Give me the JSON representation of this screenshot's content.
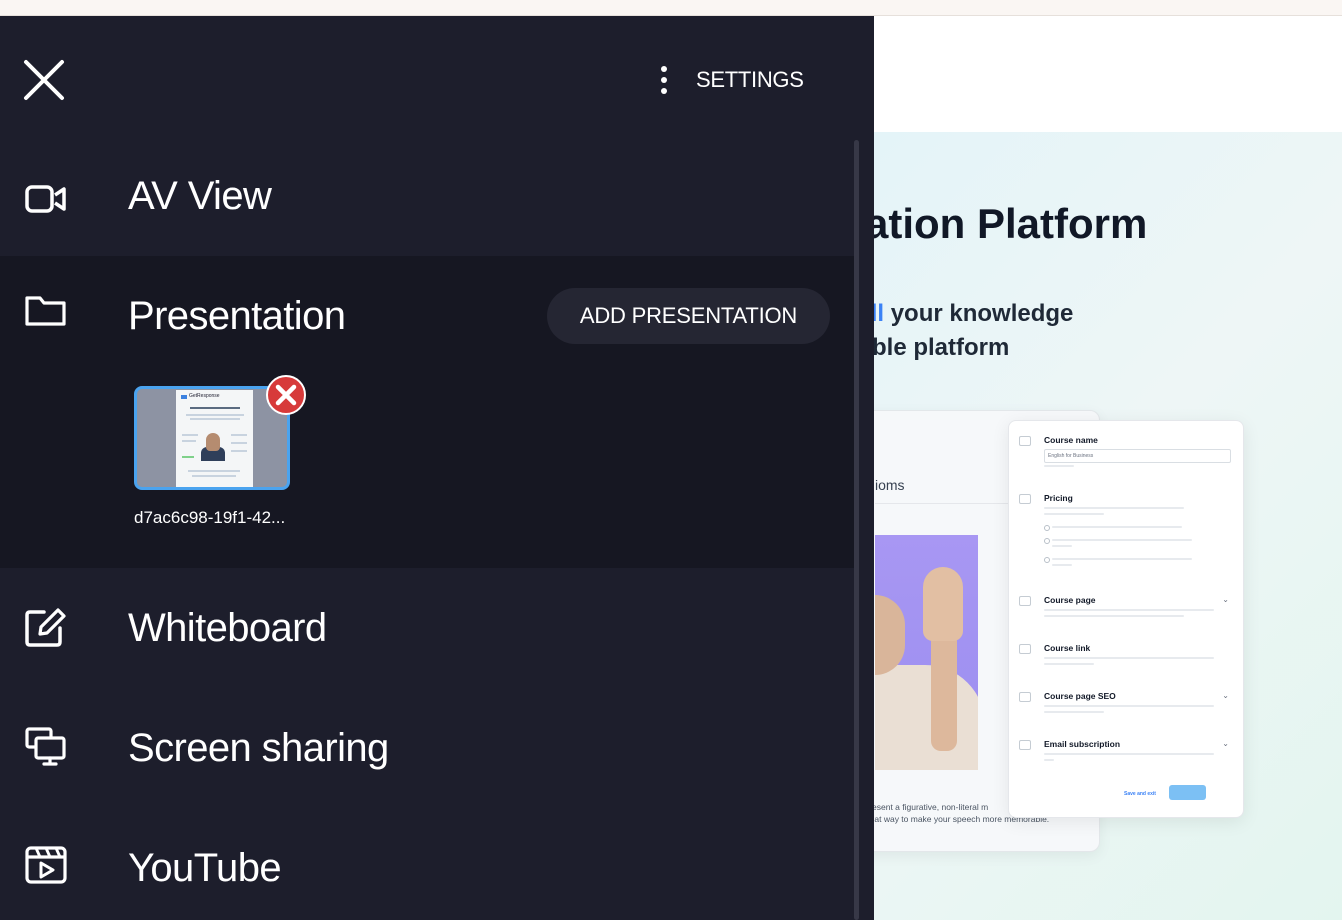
{
  "header": {
    "settings_label": "SETTINGS",
    "close_icon": "close-icon",
    "more_icon": "more-vertical-icon"
  },
  "menu": {
    "av_view": {
      "label": "AV View",
      "icon": "video-camera-icon"
    },
    "presentation": {
      "label": "Presentation",
      "icon": "folder-icon",
      "add_label": "ADD PRESENTATION"
    },
    "whiteboard": {
      "label": "Whiteboard",
      "icon": "edit-icon"
    },
    "screen_sharing": {
      "label": "Screen sharing",
      "icon": "screen-share-icon"
    },
    "youtube": {
      "label": "YouTube",
      "icon": "youtube-icon"
    }
  },
  "presentation_files": [
    {
      "name": "d7ac6c98-19f1-42...",
      "thumb_brand": "GetResponse"
    }
  ],
  "slide": {
    "title": "zation Platform",
    "subtitle_line1_highlight": "sell",
    "subtitle_line1_rest": " your knowledge",
    "subtitle_line2": "dable platform",
    "left_card_title": "ioms",
    "left_card_caption_1": "to present a figurative, non-literal m",
    "left_card_caption_2": "a great way to make your speech more memorable.",
    "form": {
      "course_name": "Course name",
      "course_name_value": "English for Business",
      "pricing": "Pricing",
      "pricing_options": [
        "Free",
        "One-time payment",
        "Subscription"
      ],
      "course_page": "Course page",
      "course_link": "Course link",
      "course_page_seo": "Course page SEO",
      "email_subscription": "Email subscription",
      "save_exit": "Save and exit",
      "publish": "Publish"
    }
  },
  "colors": {
    "sidebar_bg": "#1d1e2c",
    "active_row_bg": "#161722",
    "thumb_border": "#4aa3ef",
    "remove_badge": "#d73a3a",
    "slide_highlight": "#3b82f6"
  }
}
